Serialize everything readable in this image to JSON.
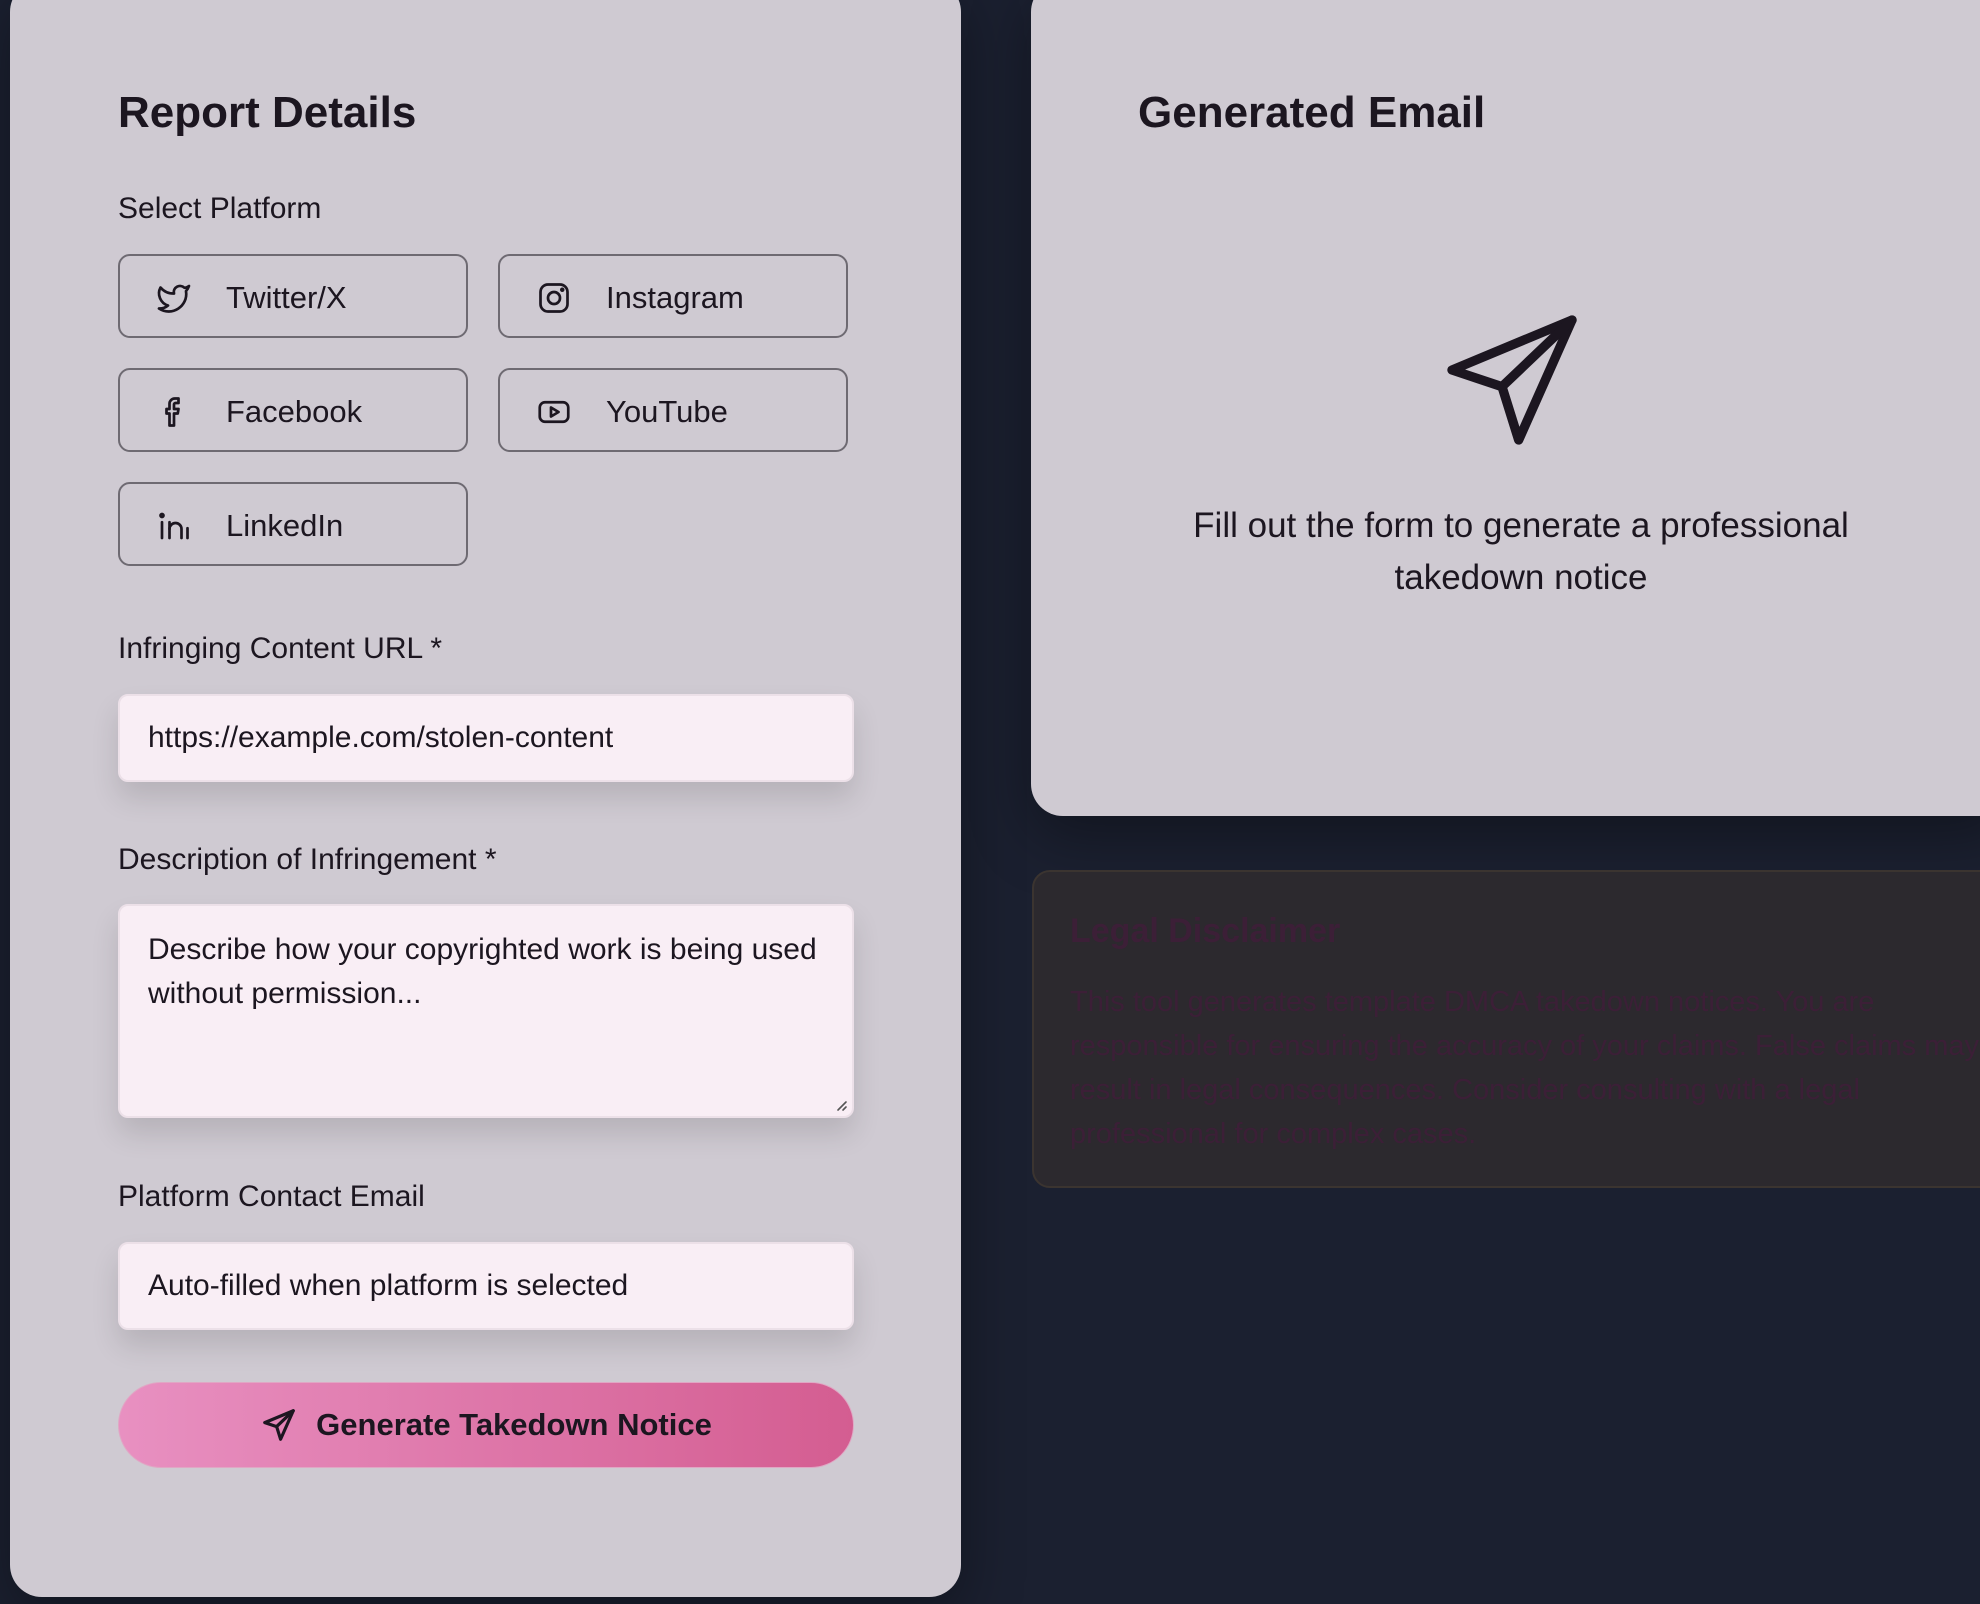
{
  "form": {
    "title": "Report Details",
    "platform_label": "Select Platform",
    "platforms": [
      {
        "label": "Twitter/X",
        "icon": "twitter-icon"
      },
      {
        "label": "Instagram",
        "icon": "instagram-icon"
      },
      {
        "label": "Facebook",
        "icon": "facebook-icon"
      },
      {
        "label": "YouTube",
        "icon": "youtube-icon"
      },
      {
        "label": "LinkedIn",
        "icon": "linkedin-icon"
      }
    ],
    "url_label": "Infringing Content URL *",
    "url_placeholder": "https://example.com/stolen-content",
    "description_label": "Description of Infringement *",
    "description_placeholder": "Describe how your copyrighted work is being used without permission...",
    "email_label": "Platform Contact Email",
    "email_placeholder": "Auto-filled when platform is selected",
    "generate_label": "Generate Takedown Notice",
    "generate_icon": "send-icon"
  },
  "email_panel": {
    "title": "Generated Email",
    "empty_icon": "send-icon",
    "empty_message": "Fill out the form to generate a professional takedown notice"
  },
  "disclaimer": {
    "title": "Legal Disclaimer",
    "body": "This tool generates template DMCA takedown notices. You are responsible for ensuring the accuracy of your claims. False claims may result in legal consequences. Consider consulting with a legal professional for complex cases."
  },
  "colors": {
    "background": "#1b2030",
    "card": "#cfcad2",
    "input": "#f9eef5",
    "accent_start": "#e890c1",
    "accent_end": "#d45d91",
    "disclaimer_text": "#3c1f37"
  }
}
